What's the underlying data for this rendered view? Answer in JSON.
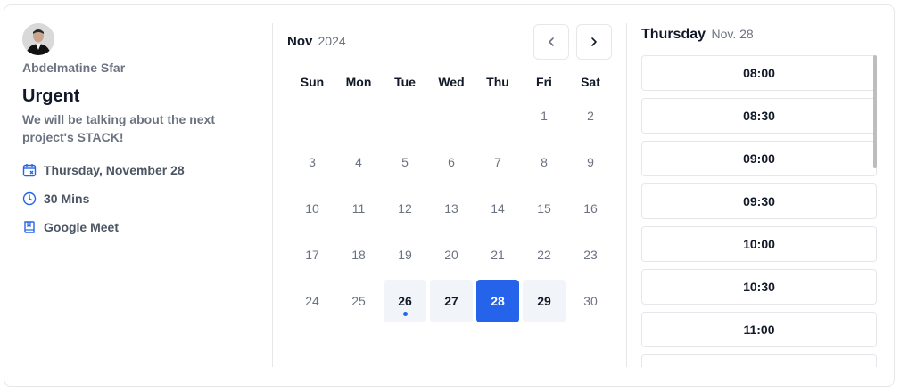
{
  "host": {
    "name": "Abdelmatine Sfar"
  },
  "event": {
    "title": "Urgent",
    "description": "We will be talking about the next project's STACK!",
    "date": "Thursday, November 28",
    "duration": "30 Mins",
    "location": "Google Meet"
  },
  "calendar": {
    "month": "Nov",
    "year": "2024",
    "weekdays": [
      "Sun",
      "Mon",
      "Tue",
      "Wed",
      "Thu",
      "Fri",
      "Sat"
    ],
    "first_weekday_index": 5,
    "days_in_month": 30,
    "available_days": [
      26,
      27,
      29
    ],
    "selected_day": 28,
    "today_marker_day": 26,
    "accent_color": "#2563eb"
  },
  "slots": {
    "day_label": "Thursday",
    "date_label": "Nov. 28",
    "times": [
      "08:00",
      "08:30",
      "09:00",
      "09:30",
      "10:00",
      "10:30",
      "11:00",
      ""
    ]
  },
  "icons": {
    "prev": "chevron-left-icon",
    "next": "chevron-right-icon",
    "date": "calendar-x-icon",
    "duration": "clock-icon",
    "location": "book-icon"
  }
}
